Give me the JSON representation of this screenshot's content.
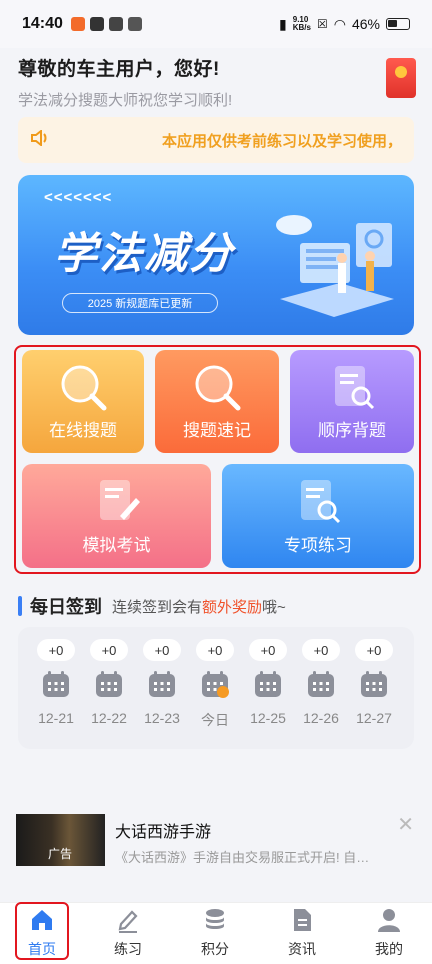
{
  "status_bar": {
    "time": "14:40",
    "speed": "9.10\nKB/s",
    "battery": "46%"
  },
  "greeting": {
    "title": "尊敬的车主用户，您好!",
    "subtitle": "学法减分搜题大师祝您学习顺利!"
  },
  "notice": {
    "text": "本应用仅供考前练习以及学习使用，"
  },
  "banner": {
    "arrows": "<<<<<<<",
    "title": "学法减分",
    "tag": "2025 新规题库已更新"
  },
  "features": [
    {
      "label": "在线搜题"
    },
    {
      "label": "搜题速记"
    },
    {
      "label": "顺序背题"
    },
    {
      "label": "模拟考试"
    },
    {
      "label": "专项练习"
    }
  ],
  "sign_in": {
    "heading": "每日签到",
    "sub_prefix": "连续签到会有",
    "sub_highlight": "额外奖励",
    "sub_suffix": "哦~",
    "days": [
      {
        "points": "+0",
        "date": "12-21"
      },
      {
        "points": "+0",
        "date": "12-22"
      },
      {
        "points": "+0",
        "date": "12-23"
      },
      {
        "points": "+0",
        "date": "今日"
      },
      {
        "points": "+0",
        "date": "12-25"
      },
      {
        "points": "+0",
        "date": "12-26"
      },
      {
        "points": "+0",
        "date": "12-27"
      }
    ]
  },
  "ad": {
    "tag": "广告",
    "title": "大话西游手游",
    "desc": "《大话西游》手游自由交易服正式开启! 自…"
  },
  "tabs": [
    {
      "label": "首页",
      "icon": "home-icon",
      "active": true
    },
    {
      "label": "练习",
      "icon": "pen-icon"
    },
    {
      "label": "积分",
      "icon": "coins-icon"
    },
    {
      "label": "资讯",
      "icon": "document-icon"
    },
    {
      "label": "我的",
      "icon": "user-icon"
    }
  ],
  "colors": {
    "accent": "#2f7bf0",
    "highlight_red": "#e2161f",
    "notice_text": "#f0a020"
  }
}
